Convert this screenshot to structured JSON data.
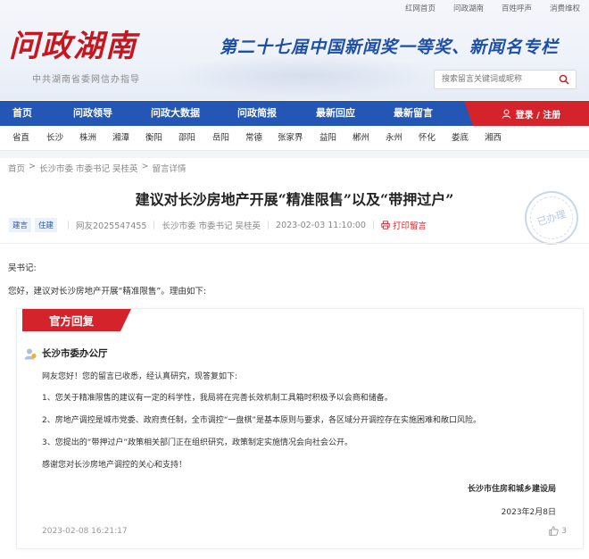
{
  "top_links": [
    "红网首页",
    "问政湖南",
    "百姓呼声",
    "消费维权"
  ],
  "header": {
    "logo": "问政湖南",
    "subtitle": "中共湖南省委网信办指导",
    "slogan": "第二十七届中国新闻奖一等奖、新闻名专栏",
    "search_placeholder": "搜索留言关键词或昵称"
  },
  "main_nav": [
    "首页",
    "问政领导",
    "问政大数据",
    "问政简报",
    "最新回应",
    "最新留言"
  ],
  "login_label": "登录 / 注册",
  "cities": [
    "省直",
    "长沙",
    "株洲",
    "湘潭",
    "衡阳",
    "邵阳",
    "岳阳",
    "常德",
    "张家界",
    "益阳",
    "郴州",
    "永州",
    "怀化",
    "娄底",
    "湘西"
  ],
  "breadcrumb": [
    "首页",
    "长沙市委 市委书记 吴桂英",
    "留言详情"
  ],
  "breadcrumb_sep": ">",
  "post": {
    "title": "建议对长沙房地产开展“精准限售”以及“带押过户”",
    "tags": [
      "建言",
      "住建"
    ],
    "author": "网友2025547455",
    "target": "长沙市委 市委书记 吴桂英",
    "time": "2023-02-03 11:10:00",
    "print_label": "打印留言",
    "status_stamp": "已办理",
    "greeting": "吴书记:",
    "body": "您好，建议对长沙房地产开展“精准限售”。理由如下:"
  },
  "reply": {
    "tab_label": "官方回复",
    "office": "长沙市委办公厅",
    "lines": [
      "网友您好！您的留言已收悉，经认真研究，现答复如下:",
      "1、您关于精准限售的建议有一定的科学性，我局将在完善长效机制工具箱时积极予以会商和储备。",
      "2、房地产调控是城市党委、政府责任制，全市调控“一盘棋”是基本原则与要求，各区域分开调控存在实施困难和敞口风险。",
      "3、您提出的“带押过户”政策相关部门正在组织研究，政策制定实施情况会向社会公开。",
      "感谢您对长沙房地产调控的关心和支持！"
    ],
    "signer": "长沙市住房和城乡建设局",
    "sign_date": "2023年2月8日",
    "reply_time": "2023-02-08 16:21:17",
    "likes": "3"
  },
  "colors": {
    "nav_blue": "#2356b5",
    "brand_red": "#d4232b",
    "slogan_blue": "#1d4fa8"
  }
}
